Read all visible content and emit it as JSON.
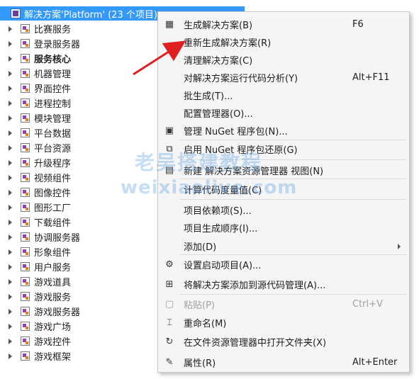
{
  "solution": {
    "root_label": "解决方案'Platform' (23 个项目)",
    "projects": [
      {
        "label": "比赛服务",
        "bold": false
      },
      {
        "label": "登录服务器",
        "bold": false
      },
      {
        "label": "服务核心",
        "bold": true
      },
      {
        "label": "机器管理",
        "bold": false
      },
      {
        "label": "界面控件",
        "bold": false
      },
      {
        "label": "进程控制",
        "bold": false
      },
      {
        "label": "模块管理",
        "bold": false
      },
      {
        "label": "平台数据",
        "bold": false
      },
      {
        "label": "平台资源",
        "bold": false
      },
      {
        "label": "升级程序",
        "bold": false
      },
      {
        "label": "视频组件",
        "bold": false
      },
      {
        "label": "图像控件",
        "bold": false
      },
      {
        "label": "图形工厂",
        "bold": false
      },
      {
        "label": "下载组件",
        "bold": false
      },
      {
        "label": "协调服务器",
        "bold": false
      },
      {
        "label": "形象组件",
        "bold": false
      },
      {
        "label": "用户服务",
        "bold": false
      },
      {
        "label": "游戏道具",
        "bold": false
      },
      {
        "label": "游戏服务",
        "bold": false
      },
      {
        "label": "游戏服务器",
        "bold": false
      },
      {
        "label": "游戏广场",
        "bold": false
      },
      {
        "label": "游戏控件",
        "bold": false
      },
      {
        "label": "游戏框架",
        "bold": false
      }
    ]
  },
  "context_menu": {
    "items": [
      {
        "label": "生成解决方案(B)",
        "shortcut": "F6",
        "icon": "build-icon",
        "disabled": false
      },
      {
        "label": "重新生成解决方案(R)",
        "shortcut": "",
        "icon": "",
        "disabled": false
      },
      {
        "label": "清理解决方案(C)",
        "shortcut": "",
        "icon": "",
        "disabled": false
      },
      {
        "label": "对解决方案运行代码分析(Y)",
        "shortcut": "Alt+F11",
        "icon": "",
        "disabled": false
      },
      {
        "label": "批生成(T)...",
        "shortcut": "",
        "icon": "",
        "disabled": false
      },
      {
        "label": "配置管理器(O)...",
        "shortcut": "",
        "icon": "",
        "disabled": false
      },
      {
        "label": "管理 NuGet 程序包(N)...",
        "shortcut": "",
        "icon": "nuget-icon",
        "disabled": false
      },
      {
        "label": "启用 NuGet 程序包还原(G)",
        "shortcut": "",
        "icon": "restore-icon",
        "disabled": false
      },
      {
        "label": "新建 解决方案资源管理器 视图(N)",
        "shortcut": "",
        "icon": "new-view-icon",
        "disabled": false
      },
      {
        "label": "计算代码度量值(C)",
        "shortcut": "",
        "icon": "",
        "disabled": false
      },
      {
        "label": "项目依赖项(S)...",
        "shortcut": "",
        "icon": "",
        "disabled": false
      },
      {
        "label": "项目生成顺序(I)...",
        "shortcut": "",
        "icon": "",
        "disabled": false
      },
      {
        "label": "添加(D)",
        "shortcut": "",
        "icon": "",
        "disabled": false,
        "submenu": true
      },
      {
        "label": "设置启动项目(A)...",
        "shortcut": "",
        "icon": "gear-icon",
        "disabled": false
      },
      {
        "label": "将解决方案添加到源代码管理(A)...",
        "shortcut": "",
        "icon": "source-control-icon",
        "disabled": false
      },
      {
        "label": "粘贴(P)",
        "shortcut": "Ctrl+V",
        "icon": "paste-icon",
        "disabled": true
      },
      {
        "label": "重命名(M)",
        "shortcut": "",
        "icon": "rename-icon",
        "disabled": false
      },
      {
        "label": "在文件资源管理器中打开文件夹(X)",
        "shortcut": "",
        "icon": "open-folder-icon",
        "disabled": false
      },
      {
        "label": "属性(R)",
        "shortcut": "Alt+Enter",
        "icon": "wrench-icon",
        "disabled": false
      }
    ]
  },
  "watermark": {
    "line1": "老吴搭建教程",
    "line2": "weixiaolive.com"
  },
  "colors": {
    "selection": "#3399ff",
    "menu_bg": "#f5f5f5",
    "arrow": "#e02020",
    "disabled": "#a0a0a0"
  }
}
